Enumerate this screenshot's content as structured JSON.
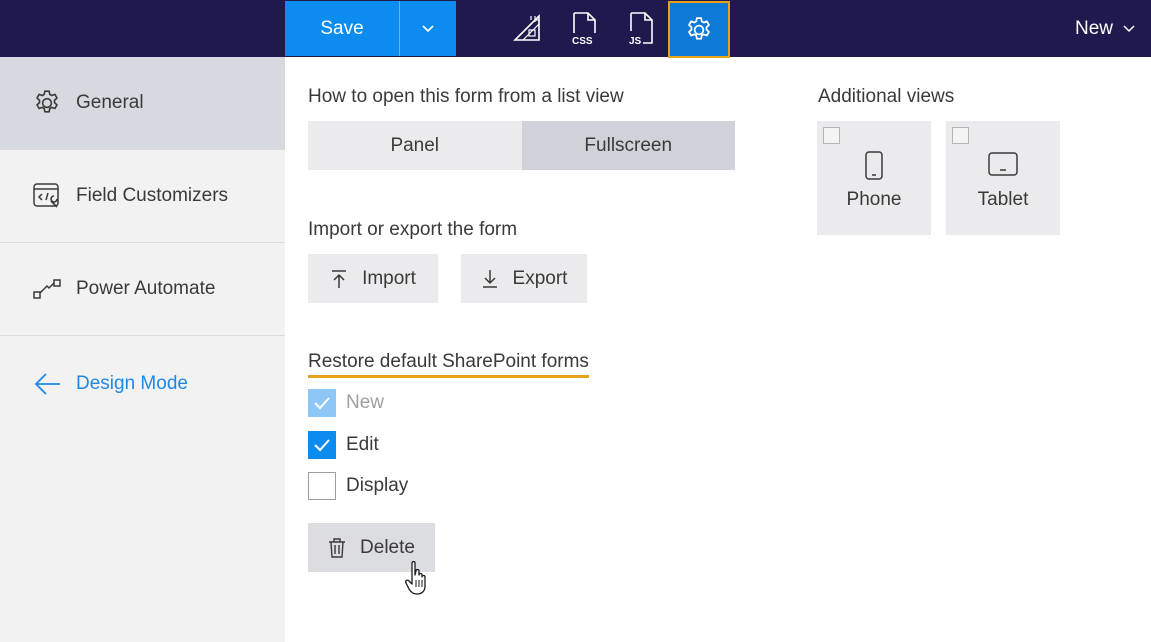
{
  "toolbar": {
    "save_label": "Save",
    "new_label": "New",
    "icons": [
      "layout-ruler-icon",
      "css-file-icon",
      "js-file-icon",
      "gear-icon"
    ]
  },
  "sidebar": {
    "items": [
      {
        "label": "General",
        "icon": "gear-icon",
        "active": true
      },
      {
        "label": "Field Customizers",
        "icon": "code-wrench-icon"
      },
      {
        "label": "Power Automate",
        "icon": "flow-icon"
      },
      {
        "label": "Design Mode",
        "icon": "arrow-left-icon"
      }
    ]
  },
  "open_form": {
    "title": "How to open this form from a list view",
    "options": [
      "Panel",
      "Fullscreen"
    ],
    "selected": "Fullscreen"
  },
  "import_export": {
    "title": "Import or export the form",
    "import_label": "Import",
    "export_label": "Export"
  },
  "restore": {
    "title": "Restore default SharePoint forms",
    "options": [
      {
        "label": "New",
        "checked": true,
        "disabled": true
      },
      {
        "label": "Edit",
        "checked": true,
        "disabled": false
      },
      {
        "label": "Display",
        "checked": false,
        "disabled": false
      }
    ],
    "delete_label": "Delete"
  },
  "additional_views": {
    "title": "Additional views",
    "views": [
      {
        "label": "Phone",
        "icon": "phone-icon",
        "checked": false
      },
      {
        "label": "Tablet",
        "icon": "tablet-icon",
        "checked": false
      }
    ]
  },
  "colors": {
    "topbar": "#1e1a4d",
    "accent": "#0d8cf0",
    "highlight": "#e8a21a",
    "design_mode": "#1e88e5"
  }
}
